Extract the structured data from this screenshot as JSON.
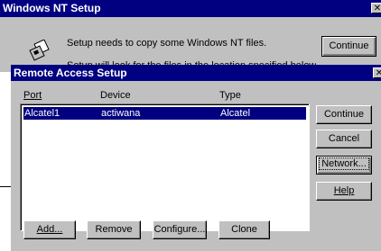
{
  "back_window": {
    "title": "Windows NT Setup",
    "close_glyph": "✕",
    "message": "Setup needs to copy some Windows NT files.",
    "message_partial": "Setup will look for the files in the location specified below",
    "continue_label": "Continue"
  },
  "front_window": {
    "title": "Remote Access Setup",
    "close_glyph": "✕",
    "columns": {
      "port": "Port",
      "device": "Device",
      "type": "Type"
    },
    "rows": [
      {
        "port": "Alcatel1",
        "device": "actiwana",
        "type": "Alcatel"
      }
    ],
    "buttons_right": {
      "continue": "Continue",
      "cancel": "Cancel",
      "network": "Network...",
      "help": "Help"
    },
    "buttons_bottom": {
      "add": "Add...",
      "remove": "Remove",
      "configure": "Configure...",
      "clone": "Clone"
    }
  },
  "icons": {
    "setup": "setup-disk-icon"
  }
}
